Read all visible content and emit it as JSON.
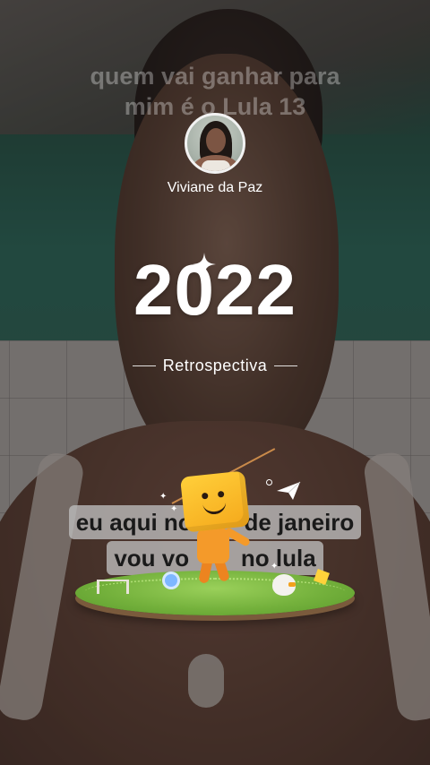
{
  "caption_top": {
    "line1": "quem vai ganhar para",
    "line2": "mim é o Lula 13"
  },
  "profile": {
    "name": "Viviane da Paz"
  },
  "year": "2022",
  "subtitle": "Retrospectiva",
  "caption_bottom": {
    "line1": "eu aqui no",
    "line1_end": "de janeiro",
    "line2": "vou vo",
    "line2_end": "no lula"
  },
  "icons": {
    "sparkle": "sparkle-icon",
    "plane": "paper-plane-icon",
    "mascot": "mascot-illustration"
  },
  "colors": {
    "text_primary": "#ffffff",
    "caption_band": "#bebebe",
    "mascot": "#f5a81b",
    "grass": "#74b13c"
  }
}
